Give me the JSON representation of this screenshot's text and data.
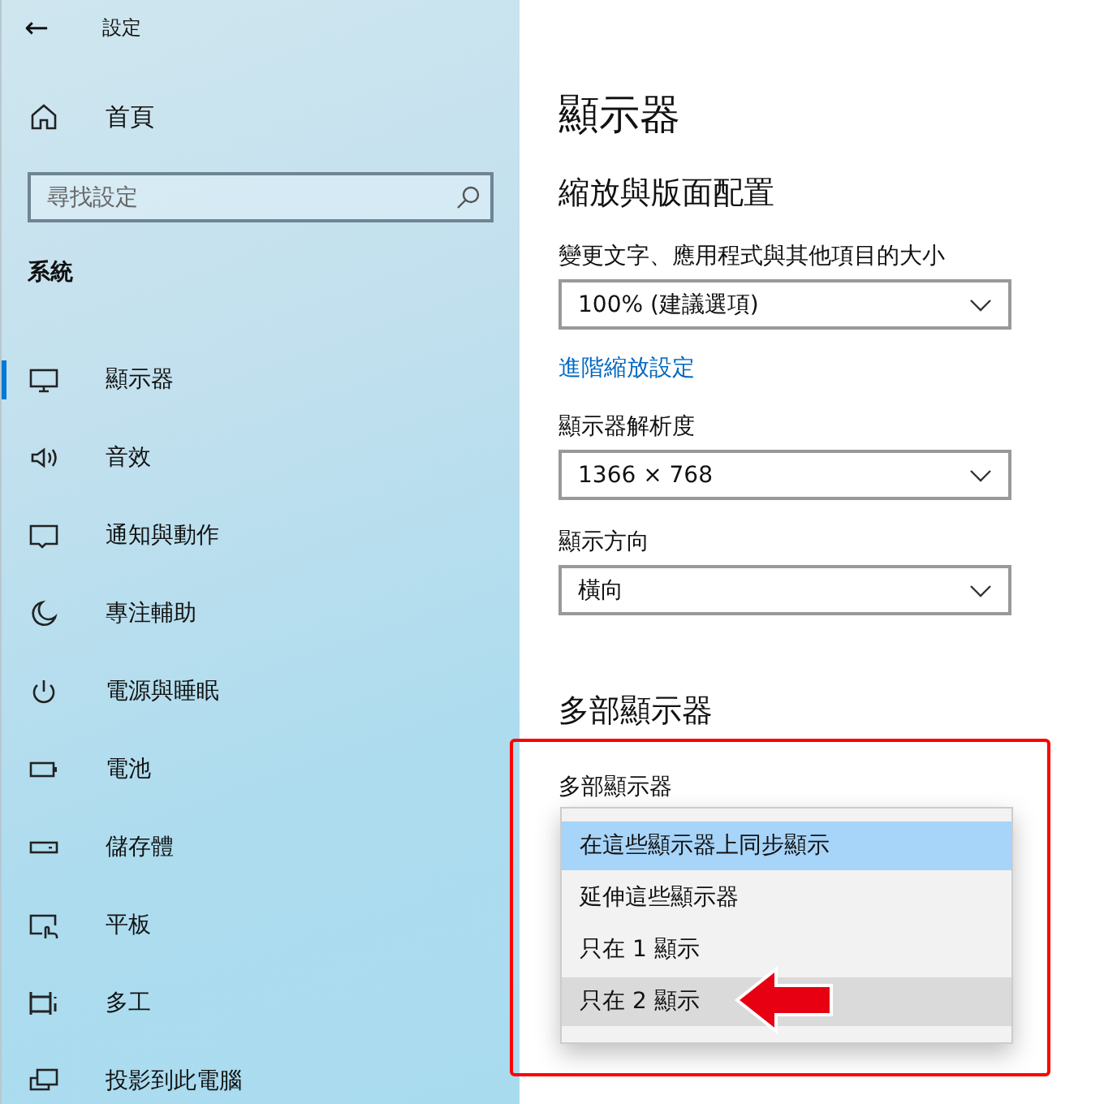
{
  "sidebar": {
    "back": "←",
    "title": "設定",
    "home": "首頁",
    "search": {
      "placeholder": "尋找設定"
    },
    "section": "系統",
    "items": [
      {
        "label": "顯示器",
        "kind": "monitor",
        "selected": true
      },
      {
        "label": "音效",
        "kind": "speaker",
        "selected": false
      },
      {
        "label": "通知與動作",
        "kind": "message",
        "selected": false
      },
      {
        "label": "專注輔助",
        "kind": "moon",
        "selected": false
      },
      {
        "label": "電源與睡眠",
        "kind": "power",
        "selected": false
      },
      {
        "label": "電池",
        "kind": "battery",
        "selected": false
      },
      {
        "label": "儲存體",
        "kind": "storage",
        "selected": false
      },
      {
        "label": "平板",
        "kind": "tablet",
        "selected": false
      },
      {
        "label": "多工",
        "kind": "multitask",
        "selected": false
      },
      {
        "label": "投影到此電腦",
        "kind": "project",
        "selected": false
      }
    ]
  },
  "main": {
    "title": "顯示器",
    "section": "縮放與版面配置",
    "fields": [
      {
        "kind": "select",
        "label": "變更文字、應用程式與其他項目的大小",
        "value": "100% (建議選項)"
      },
      {
        "kind": "link",
        "label": "進階縮放設定"
      },
      {
        "kind": "select",
        "label": "顯示器解析度",
        "value": "1366 × 768"
      },
      {
        "kind": "select",
        "label": "顯示方向",
        "value": "橫向"
      }
    ],
    "section2": "多部顯示器",
    "multi_label": "多部顯示器",
    "menu": [
      {
        "label": "在這些顯示器上同步顯示",
        "selected": true,
        "hovered": false
      },
      {
        "label": "延伸這些顯示器",
        "selected": false,
        "hovered": false
      },
      {
        "label": "只在 1 顯示",
        "selected": false,
        "hovered": false
      },
      {
        "label": "只在 2 顯示",
        "selected": false,
        "hovered": true
      }
    ]
  }
}
